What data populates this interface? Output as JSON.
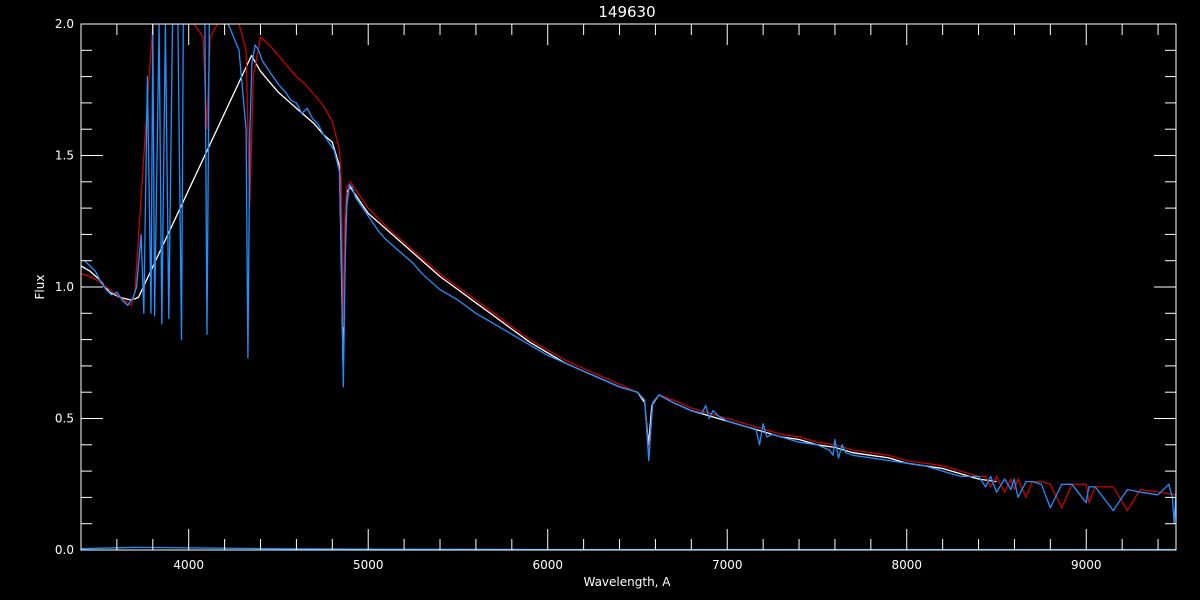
{
  "chart_data": {
    "type": "line",
    "title": "149630",
    "xlabel": "Wavelength, A",
    "ylabel": "Flux",
    "xlim": [
      3400,
      9500
    ],
    "ylim": [
      0.0,
      2.0
    ],
    "x_ticks": [
      "4000",
      "5000",
      "6000",
      "7000",
      "8000",
      "9000"
    ],
    "y_ticks": [
      "0.0",
      "0.5",
      "1.0",
      "1.5",
      "2.0"
    ],
    "background": "#000000",
    "axis_color": "#ffffff",
    "legend": "none",
    "grid": false,
    "series": [
      {
        "color": "#ffffff",
        "x": [
          3400,
          3450,
          3500,
          3560,
          3620,
          3680,
          3720,
          4350,
          4400,
          4450,
          4500,
          4550,
          4600,
          4650,
          4700,
          4750,
          4800,
          4840,
          4850,
          4860,
          4870,
          4880,
          4900,
          4950,
          5000,
          5100,
          5200,
          5300,
          5400,
          5500,
          5600,
          5700,
          5800,
          5900,
          6000,
          6100,
          6200,
          6300,
          6400,
          6500,
          6540,
          6562,
          6580,
          6620,
          6700,
          6800,
          6900,
          7000,
          7100,
          7200,
          7300,
          7400,
          7500,
          7600,
          7700,
          7800,
          7900,
          8000,
          8100,
          8200,
          8300,
          8400,
          8500
        ],
        "y": [
          1.08,
          1.06,
          1.03,
          0.98,
          0.96,
          0.95,
          0.96,
          1.88,
          1.82,
          1.78,
          1.74,
          1.71,
          1.68,
          1.65,
          1.62,
          1.58,
          1.55,
          1.46,
          1.1,
          0.7,
          1.1,
          1.36,
          1.38,
          1.33,
          1.28,
          1.22,
          1.16,
          1.1,
          1.04,
          0.99,
          0.94,
          0.89,
          0.84,
          0.79,
          0.75,
          0.71,
          0.68,
          0.65,
          0.62,
          0.6,
          0.56,
          0.4,
          0.55,
          0.59,
          0.56,
          0.53,
          0.51,
          0.49,
          0.47,
          0.45,
          0.43,
          0.42,
          0.4,
          0.39,
          0.37,
          0.36,
          0.35,
          0.33,
          0.32,
          0.31,
          0.29,
          0.27,
          0.26
        ]
      },
      {
        "color": "#cc0000",
        "x": [
          3400,
          3450,
          3500,
          3560,
          3620,
          3680,
          3700,
          3760,
          3800,
          3840,
          3880,
          3930,
          3980,
          4030,
          4080,
          4100,
          4120,
          4160,
          4220,
          4280,
          4320,
          4340,
          4360,
          4400,
          4450,
          4500,
          4550,
          4600,
          4650,
          4700,
          4750,
          4800,
          4840,
          4850,
          4861,
          4870,
          4880,
          4900,
          4950,
          5000,
          5100,
          5200,
          5300,
          5400,
          5500,
          5600,
          5700,
          5800,
          5900,
          6000,
          6100,
          6200,
          6300,
          6400,
          6500,
          6540,
          6563,
          6585,
          6620,
          6700,
          6800,
          6900,
          7000,
          7100,
          7200,
          7300,
          7400,
          7500,
          7600,
          7700,
          7800,
          7900,
          8000,
          8100,
          8200,
          8300,
          8400,
          8440,
          8467,
          8500,
          8545,
          8580,
          8598,
          8620,
          8665,
          8700,
          8750,
          8800,
          8863,
          8920,
          9000,
          9015,
          9050,
          9150,
          9229,
          9300,
          9400,
          9500
        ],
        "y": [
          1.05,
          1.04,
          1.02,
          0.99,
          0.96,
          0.93,
          0.98,
          1.6,
          2.0,
          2.0,
          2.0,
          2.0,
          2.0,
          2.0,
          1.95,
          1.6,
          1.95,
          2.0,
          2.0,
          2.0,
          1.9,
          1.3,
          1.8,
          1.95,
          1.92,
          1.88,
          1.84,
          1.8,
          1.77,
          1.73,
          1.69,
          1.63,
          1.52,
          1.4,
          0.85,
          1.25,
          1.38,
          1.4,
          1.35,
          1.3,
          1.23,
          1.17,
          1.11,
          1.05,
          1.0,
          0.95,
          0.9,
          0.85,
          0.8,
          0.76,
          0.72,
          0.69,
          0.66,
          0.63,
          0.6,
          0.57,
          0.36,
          0.56,
          0.59,
          0.57,
          0.54,
          0.52,
          0.5,
          0.48,
          0.46,
          0.44,
          0.43,
          0.41,
          0.4,
          0.38,
          0.37,
          0.36,
          0.34,
          0.33,
          0.32,
          0.3,
          0.28,
          0.28,
          0.24,
          0.28,
          0.22,
          0.27,
          0.23,
          0.27,
          0.2,
          0.26,
          0.26,
          0.25,
          0.16,
          0.25,
          0.25,
          0.18,
          0.24,
          0.24,
          0.15,
          0.23,
          0.22,
          0.21
        ]
      },
      {
        "color": "#1e90ff",
        "x": [
          3420,
          3450,
          3480,
          3510,
          3540,
          3570,
          3600,
          3630,
          3660,
          3690,
          3710,
          3735,
          3750,
          3770,
          3790,
          3800,
          3810,
          3835,
          3850,
          3870,
          3889,
          3910,
          3940,
          3960,
          3970,
          3985,
          4020,
          4060,
          4090,
          4102,
          4115,
          4160,
          4220,
          4280,
          4320,
          4330,
          4341,
          4352,
          4370,
          4390,
          4410,
          4440,
          4470,
          4500,
          4540,
          4570,
          4600,
          4630,
          4660,
          4690,
          4720,
          4750,
          4780,
          4810,
          4840,
          4850,
          4861,
          4872,
          4880,
          4895,
          4910,
          4930,
          4960,
          5000,
          5030,
          5060,
          5100,
          5150,
          5200,
          5250,
          5300,
          5350,
          5400,
          5500,
          5600,
          5700,
          5800,
          5900,
          6000,
          6100,
          6200,
          6300,
          6400,
          6500,
          6540,
          6563,
          6585,
          6620,
          6700,
          6800,
          6860,
          6880,
          6900,
          6920,
          6950,
          7000,
          7100,
          7160,
          7180,
          7200,
          7220,
          7250,
          7300,
          7400,
          7500,
          7570,
          7590,
          7600,
          7620,
          7640,
          7660,
          7700,
          7800,
          7900,
          8000,
          8100,
          8200,
          8300,
          8400,
          8440,
          8467,
          8500,
          8545,
          8580,
          8598,
          8620,
          8665,
          8700,
          8750,
          8800,
          8863,
          8920,
          9000,
          9015,
          9050,
          9150,
          9229,
          9300,
          9400,
          9460,
          9480,
          9490,
          9500
        ],
        "y": [
          1.1,
          1.08,
          1.06,
          1.02,
          0.99,
          0.97,
          0.98,
          0.95,
          0.93,
          0.96,
          1.0,
          1.2,
          0.9,
          1.8,
          0.9,
          2.0,
          0.89,
          2.0,
          0.86,
          2.0,
          0.88,
          2.0,
          2.0,
          0.8,
          2.0,
          2.0,
          2.0,
          2.0,
          2.0,
          0.82,
          2.0,
          2.0,
          2.0,
          1.9,
          1.6,
          0.73,
          1.6,
          1.85,
          1.92,
          1.9,
          1.86,
          1.83,
          1.8,
          1.77,
          1.74,
          1.71,
          1.7,
          1.66,
          1.68,
          1.64,
          1.62,
          1.58,
          1.55,
          1.52,
          1.44,
          1.15,
          0.62,
          1.1,
          1.3,
          1.39,
          1.38,
          1.34,
          1.31,
          1.27,
          1.24,
          1.21,
          1.18,
          1.15,
          1.12,
          1.09,
          1.05,
          1.02,
          0.99,
          0.95,
          0.9,
          0.86,
          0.82,
          0.78,
          0.74,
          0.71,
          0.68,
          0.65,
          0.62,
          0.6,
          0.57,
          0.34,
          0.56,
          0.59,
          0.56,
          0.53,
          0.52,
          0.55,
          0.5,
          0.53,
          0.51,
          0.49,
          0.47,
          0.46,
          0.4,
          0.48,
          0.43,
          0.44,
          0.43,
          0.41,
          0.4,
          0.38,
          0.36,
          0.42,
          0.35,
          0.4,
          0.37,
          0.36,
          0.35,
          0.34,
          0.33,
          0.32,
          0.3,
          0.28,
          0.28,
          0.24,
          0.28,
          0.22,
          0.27,
          0.23,
          0.27,
          0.2,
          0.26,
          0.26,
          0.25,
          0.16,
          0.25,
          0.25,
          0.18,
          0.24,
          0.24,
          0.15,
          0.23,
          0.22,
          0.21,
          0.25,
          0.2,
          0.1,
          0.22
        ]
      },
      {
        "color": "#1e90ff",
        "x": [
          3400,
          3700,
          4000,
          4300,
          4600,
          5000,
          6000,
          7000,
          8000,
          9000,
          9500
        ],
        "y": [
          0.005,
          0.01,
          0.008,
          0.006,
          0.004,
          0.003,
          0.002,
          0.002,
          0.002,
          0.002,
          0.002
        ]
      }
    ]
  }
}
